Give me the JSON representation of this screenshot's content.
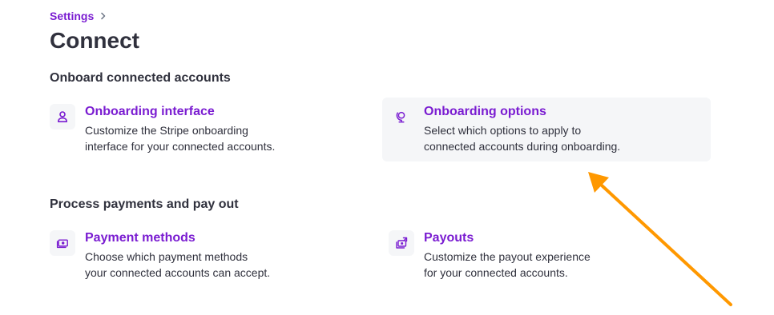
{
  "breadcrumb": {
    "settings_label": "Settings"
  },
  "page": {
    "title": "Connect"
  },
  "sections": [
    {
      "heading": "Onboard connected accounts",
      "cards": [
        {
          "title": "Onboarding interface",
          "desc_line1": "Customize the Stripe onboarding",
          "desc_line2": "interface for your connected accounts.",
          "icon": "person-icon"
        },
        {
          "title": "Onboarding options",
          "desc_line1": "Select which options to apply to",
          "desc_line2": "connected accounts during onboarding.",
          "icon": "globe-stand-icon"
        }
      ]
    },
    {
      "heading": "Process payments and pay out",
      "cards": [
        {
          "title": "Payment methods",
          "desc_line1": "Choose which payment methods",
          "desc_line2": "your connected accounts can accept.",
          "icon": "money-card-icon"
        },
        {
          "title": "Payouts",
          "desc_line1": "Customize the payout experience",
          "desc_line2": "for your connected accounts.",
          "icon": "payout-icon"
        }
      ]
    }
  ],
  "colors": {
    "accent": "#7a1cd1",
    "text": "#30313d",
    "icon_bg": "#f5f6f8",
    "annotation_arrow": "#ff9800"
  }
}
